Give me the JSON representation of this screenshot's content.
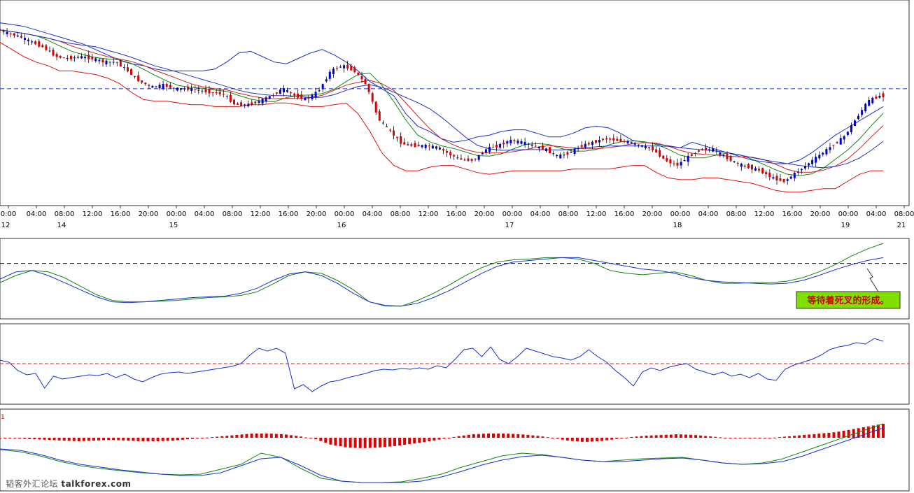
{
  "colors": {
    "background": "#ffffff",
    "panel_border": "#333333",
    "bull_candle": "#0000cc",
    "bear_candle": "#dd0000",
    "bollinger_upper": "#1a2fd0",
    "bollinger_lower": "#e01010",
    "ma_green": "#118811",
    "ma_red": "#cc2222",
    "ma_blue": "#2233cc",
    "price_line": "#1a2fd0",
    "stoch_k": "#118811",
    "stoch_d": "#1a2fd0",
    "rsi_line": "#1a2fd0",
    "rsi_mid": "#dd2222",
    "macd_hist": "#dd0000",
    "macd_line": "#118811",
    "signal_line": "#1a2fd0",
    "annotation_bg": "#7fe000",
    "annotation_text": "#cc0000"
  },
  "watermark": {
    "cn": "韬客外汇论坛",
    "site": "talkforex.com"
  },
  "chart_data": [
    {
      "type": "line",
      "panel": "price",
      "price_line_level": 0.62,
      "time_axis": {
        "time_labels": [
          "0:00",
          "04:00",
          "08:00",
          "12:00",
          "16:00",
          "20:00",
          "00:00",
          "04:00",
          "08:00",
          "12:00",
          "16:00",
          "20:00",
          "00:00",
          "04:00",
          "08:00",
          "12:00",
          "16:00",
          "20:00",
          "00:00",
          "04:00",
          "08:00",
          "12:00",
          "16:00",
          "20:00",
          "00:00",
          "04:00",
          "08:00",
          "12:00",
          "16:00",
          "20:00",
          "00:00",
          "04:00",
          "08:00"
        ],
        "date_labels": [
          {
            "index": 0,
            "label": "12"
          },
          {
            "index": 2,
            "label": "14"
          },
          {
            "index": 6,
            "label": "15"
          },
          {
            "index": 12,
            "label": "16"
          },
          {
            "index": 18,
            "label": "17"
          },
          {
            "index": 24,
            "label": "18"
          },
          {
            "index": 30,
            "label": "19"
          },
          {
            "index": 32,
            "label": "21"
          }
        ]
      },
      "close_series": [
        0.95,
        0.93,
        0.91,
        0.88,
        0.85,
        0.8,
        0.79,
        0.8,
        0.79,
        0.77,
        0.77,
        0.72,
        0.66,
        0.63,
        0.64,
        0.62,
        0.62,
        0.61,
        0.6,
        0.59,
        0.53,
        0.53,
        0.55,
        0.58,
        0.62,
        0.58,
        0.56,
        0.61,
        0.72,
        0.75,
        0.72,
        0.64,
        0.45,
        0.38,
        0.31,
        0.3,
        0.3,
        0.29,
        0.25,
        0.22,
        0.22,
        0.28,
        0.3,
        0.33,
        0.32,
        0.3,
        0.28,
        0.24,
        0.26,
        0.3,
        0.32,
        0.34,
        0.33,
        0.32,
        0.3,
        0.28,
        0.22,
        0.19,
        0.24,
        0.28,
        0.28,
        0.24,
        0.2,
        0.18,
        0.16,
        0.12,
        0.1,
        0.15,
        0.2,
        0.25,
        0.3,
        0.35,
        0.45,
        0.55,
        0.58
      ],
      "upper_band": [
        0.99,
        0.98,
        0.97,
        0.95,
        0.93,
        0.91,
        0.89,
        0.87,
        0.84,
        0.81,
        0.78,
        0.76,
        0.75,
        0.73,
        0.72,
        0.72,
        0.72,
        0.72,
        0.73,
        0.77,
        0.82,
        0.83,
        0.8,
        0.77,
        0.76,
        0.79,
        0.82,
        0.84,
        0.81,
        0.77,
        0.72,
        0.66,
        0.62,
        0.58,
        0.48,
        0.41,
        0.38,
        0.34,
        0.32,
        0.33,
        0.35,
        0.36,
        0.38,
        0.39,
        0.39,
        0.37,
        0.35,
        0.35,
        0.37,
        0.4,
        0.41,
        0.4,
        0.37,
        0.33,
        0.32,
        0.31,
        0.3,
        0.29,
        0.32,
        0.3,
        0.28,
        0.26,
        0.24,
        0.22,
        0.21,
        0.2,
        0.2,
        0.22,
        0.26,
        0.31,
        0.36,
        0.4,
        0.44,
        0.48,
        0.52
      ],
      "lower_band": [
        0.88,
        0.84,
        0.8,
        0.77,
        0.75,
        0.72,
        0.72,
        0.71,
        0.7,
        0.68,
        0.65,
        0.6,
        0.56,
        0.55,
        0.55,
        0.54,
        0.53,
        0.53,
        0.52,
        0.52,
        0.52,
        0.53,
        0.53,
        0.54,
        0.54,
        0.53,
        0.52,
        0.52,
        0.53,
        0.54,
        0.48,
        0.38,
        0.26,
        0.19,
        0.16,
        0.16,
        0.18,
        0.19,
        0.19,
        0.17,
        0.15,
        0.14,
        0.15,
        0.16,
        0.16,
        0.16,
        0.16,
        0.16,
        0.17,
        0.17,
        0.17,
        0.17,
        0.18,
        0.19,
        0.19,
        0.15,
        0.12,
        0.11,
        0.11,
        0.12,
        0.12,
        0.11,
        0.1,
        0.09,
        0.07,
        0.05,
        0.04,
        0.04,
        0.05,
        0.06,
        0.06,
        0.1,
        0.14,
        0.16,
        0.16
      ]
    },
    {
      "type": "line",
      "panel": "stochastic",
      "reference_level": 0.72,
      "series": [
        {
          "values": [
            0.45,
            0.55,
            0.62,
            0.6,
            0.52,
            0.4,
            0.28,
            0.2,
            0.18,
            0.18,
            0.19,
            0.2,
            0.22,
            0.24,
            0.25,
            0.27,
            0.32,
            0.43,
            0.55,
            0.6,
            0.58,
            0.48,
            0.35,
            0.18,
            0.12,
            0.12,
            0.2,
            0.3,
            0.42,
            0.55,
            0.66,
            0.74,
            0.77,
            0.78,
            0.8,
            0.8,
            0.78,
            0.72,
            0.62,
            0.58,
            0.56,
            0.58,
            0.6,
            0.55,
            0.48,
            0.44,
            0.44,
            0.45,
            0.45,
            0.47,
            0.52,
            0.6,
            0.7,
            0.82,
            0.92,
            1.0
          ]
        },
        {
          "values": [
            0.5,
            0.6,
            0.62,
            0.55,
            0.45,
            0.35,
            0.25,
            0.18,
            0.17,
            0.18,
            0.2,
            0.22,
            0.24,
            0.25,
            0.26,
            0.3,
            0.37,
            0.48,
            0.57,
            0.6,
            0.55,
            0.44,
            0.3,
            0.18,
            0.13,
            0.12,
            0.16,
            0.24,
            0.34,
            0.46,
            0.58,
            0.68,
            0.74,
            0.76,
            0.78,
            0.8,
            0.8,
            0.76,
            0.72,
            0.68,
            0.64,
            0.62,
            0.58,
            0.52,
            0.48,
            0.46,
            0.45,
            0.44,
            0.43,
            0.44,
            0.48,
            0.55,
            0.63,
            0.7,
            0.76,
            0.8
          ]
        }
      ]
    },
    {
      "type": "line",
      "panel": "rsi",
      "reference_level": 0.5,
      "values": [
        0.55,
        0.52,
        0.4,
        0.34,
        0.36,
        0.15,
        0.32,
        0.28,
        0.3,
        0.32,
        0.34,
        0.33,
        0.36,
        0.3,
        0.35,
        0.28,
        0.24,
        0.3,
        0.35,
        0.37,
        0.38,
        0.36,
        0.38,
        0.4,
        0.42,
        0.44,
        0.46,
        0.5,
        0.62,
        0.72,
        0.68,
        0.72,
        0.65,
        0.14,
        0.2,
        0.1,
        0.18,
        0.24,
        0.26,
        0.3,
        0.33,
        0.36,
        0.4,
        0.42,
        0.41,
        0.43,
        0.42,
        0.44,
        0.42,
        0.47,
        0.44,
        0.56,
        0.7,
        0.72,
        0.6,
        0.74,
        0.56,
        0.5,
        0.6,
        0.72,
        0.68,
        0.64,
        0.6,
        0.58,
        0.55,
        0.6,
        0.7,
        0.6,
        0.52,
        0.4,
        0.3,
        0.18,
        0.38,
        0.44,
        0.4,
        0.45,
        0.48,
        0.5,
        0.42,
        0.38,
        0.34,
        0.38,
        0.32,
        0.35,
        0.3,
        0.36,
        0.28,
        0.26,
        0.42,
        0.48,
        0.52,
        0.56,
        0.62,
        0.7,
        0.74,
        0.76,
        0.8,
        0.78,
        0.86,
        0.82
      ]
    },
    {
      "type": "line",
      "panel": "macd",
      "label": "1",
      "zero_level": 0.72,
      "histogram": [
        0.72,
        0.71,
        0.7,
        0.69,
        0.68,
        0.67,
        0.68,
        0.69,
        0.68,
        0.67,
        0.67,
        0.68,
        0.7,
        0.72,
        0.74,
        0.76,
        0.78,
        0.78,
        0.77,
        0.74,
        0.7,
        0.62,
        0.58,
        0.57,
        0.58,
        0.6,
        0.63,
        0.66,
        0.7,
        0.74,
        0.77,
        0.78,
        0.78,
        0.77,
        0.75,
        0.72,
        0.68,
        0.66,
        0.67,
        0.7,
        0.73,
        0.75,
        0.76,
        0.77,
        0.76,
        0.74,
        0.72,
        0.71,
        0.71,
        0.72,
        0.74,
        0.76,
        0.78,
        0.8,
        0.84,
        0.88,
        0.92
      ],
      "series": [
        {
          "values": [
            0.55,
            0.52,
            0.46,
            0.38,
            0.32,
            0.28,
            0.25,
            0.22,
            0.2,
            0.19,
            0.2,
            0.27,
            0.34,
            0.5,
            0.44,
            0.28,
            0.14,
            0.1,
            0.08,
            0.08,
            0.09,
            0.14,
            0.2,
            0.3,
            0.38,
            0.46,
            0.5,
            0.48,
            0.44,
            0.4,
            0.38,
            0.4,
            0.42,
            0.43,
            0.44,
            0.4,
            0.36,
            0.34,
            0.36,
            0.42,
            0.52,
            0.62,
            0.72,
            0.82,
            0.92
          ]
        },
        {
          "values": [
            0.56,
            0.54,
            0.48,
            0.4,
            0.34,
            0.3,
            0.26,
            0.23,
            0.2,
            0.18,
            0.18,
            0.22,
            0.32,
            0.42,
            0.44,
            0.32,
            0.18,
            0.1,
            0.08,
            0.08,
            0.08,
            0.1,
            0.16,
            0.24,
            0.33,
            0.4,
            0.45,
            0.47,
            0.44,
            0.4,
            0.38,
            0.38,
            0.4,
            0.42,
            0.43,
            0.4,
            0.36,
            0.34,
            0.35,
            0.38,
            0.46,
            0.56,
            0.66,
            0.76,
            0.86
          ]
        }
      ]
    }
  ],
  "annotation": {
    "text": "等待着死叉的形成。"
  }
}
